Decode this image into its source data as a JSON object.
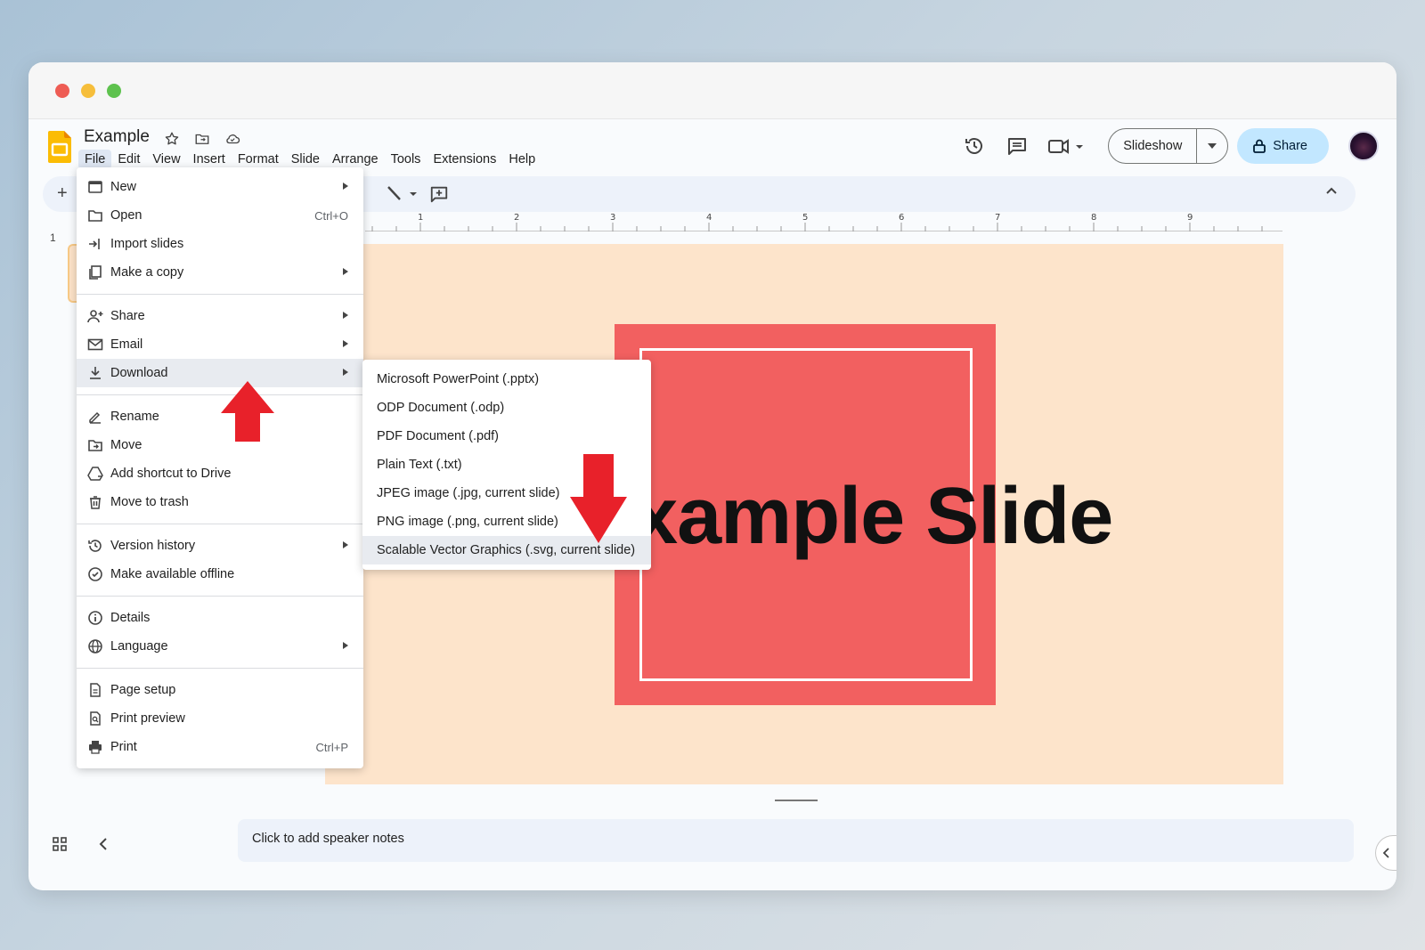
{
  "window": {
    "controls": [
      "close",
      "minimize",
      "maximize"
    ]
  },
  "app": {
    "doc_title": "Example",
    "title_icons": [
      "star-icon",
      "move-folder-icon",
      "cloud-status-icon"
    ],
    "menu": [
      "File",
      "Edit",
      "View",
      "Insert",
      "Format",
      "Slide",
      "Arrange",
      "Tools",
      "Extensions",
      "Help"
    ],
    "active_menu": "File",
    "slideshow_label": "Slideshow",
    "share_label": "Share"
  },
  "ruler": {
    "marks": [
      "1",
      "2",
      "3",
      "4",
      "5",
      "6",
      "7",
      "8",
      "9"
    ]
  },
  "filmstrip": {
    "slide_number": "1"
  },
  "slide": {
    "visible_text": "an Example Slide",
    "background": "#fde4cb",
    "square_color": "#f26060"
  },
  "notes": {
    "placeholder": "Click to add speaker notes"
  },
  "file_menu": {
    "items": [
      {
        "label": "New",
        "icon": "new-icon",
        "submenu": true
      },
      {
        "label": "Open",
        "icon": "folder-icon",
        "shortcut": "Ctrl+O"
      },
      {
        "label": "Import slides",
        "icon": "import-icon"
      },
      {
        "label": "Make a copy",
        "icon": "copy-icon",
        "submenu": true
      },
      {
        "label": "Share",
        "icon": "person-add-icon",
        "submenu": true
      },
      {
        "label": "Email",
        "icon": "email-icon",
        "submenu": true
      },
      {
        "label": "Download",
        "icon": "download-icon",
        "submenu": true,
        "highlighted": true
      },
      {
        "label": "Rename",
        "icon": "rename-icon"
      },
      {
        "label": "Move",
        "icon": "move-folder-icon"
      },
      {
        "label": "Add shortcut to Drive",
        "icon": "drive-shortcut-icon"
      },
      {
        "label": "Move to trash",
        "icon": "trash-icon"
      },
      {
        "label": "Version history",
        "icon": "history-icon",
        "submenu": true
      },
      {
        "label": "Make available offline",
        "icon": "offline-icon"
      },
      {
        "label": "Details",
        "icon": "info-icon"
      },
      {
        "label": "Language",
        "icon": "globe-icon",
        "submenu": true
      },
      {
        "label": "Page setup",
        "icon": "page-icon"
      },
      {
        "label": "Print preview",
        "icon": "print-preview-icon"
      },
      {
        "label": "Print",
        "icon": "print-icon",
        "shortcut": "Ctrl+P"
      }
    ]
  },
  "download_menu": {
    "items": [
      {
        "label": "Microsoft PowerPoint (.pptx)"
      },
      {
        "label": "ODP Document (.odp)"
      },
      {
        "label": "PDF Document (.pdf)"
      },
      {
        "label": "Plain Text (.txt)"
      },
      {
        "label": "JPEG image (.jpg, current slide)"
      },
      {
        "label": "PNG image (.png, current slide)"
      },
      {
        "label": "Scalable Vector Graphics (.svg, current slide)",
        "highlighted": true
      }
    ]
  },
  "annotations": {
    "arrow_color": "#e8212a"
  }
}
